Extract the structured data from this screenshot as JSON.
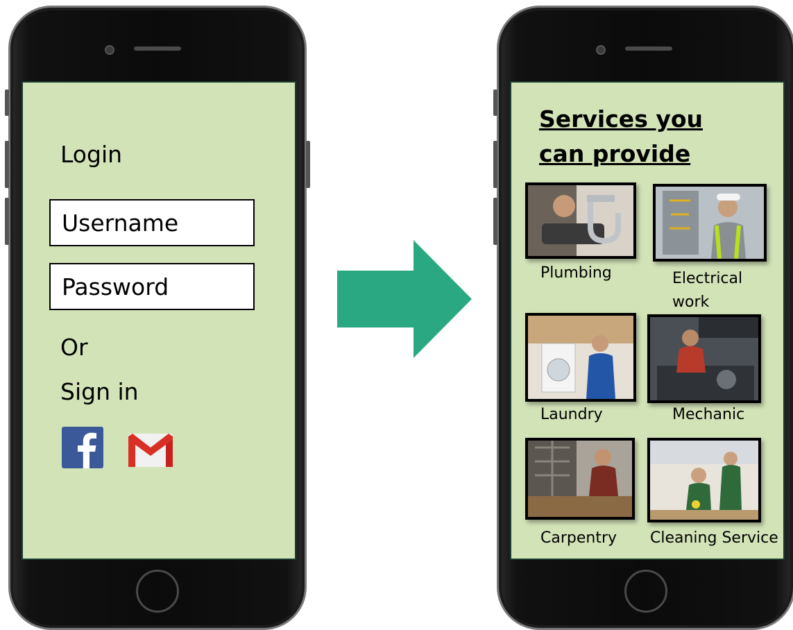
{
  "login_screen": {
    "title": "Login",
    "username_placeholder": "Username",
    "password_placeholder": "Password",
    "or_text": "Or",
    "sign_in_text": "Sign in",
    "social": [
      "facebook-icon",
      "gmail-icon"
    ]
  },
  "services_screen": {
    "heading_line1": "Services you",
    "heading_line2": "can provide",
    "services": [
      {
        "label": "Plumbing",
        "icon": "plumbing-photo"
      },
      {
        "label_line1": "Electrical",
        "label_line2": "work",
        "icon": "electrical-photo"
      },
      {
        "label": "Laundry",
        "icon": "laundry-photo"
      },
      {
        "label": "Mechanic",
        "icon": "mechanic-photo"
      },
      {
        "label": "Carpentry",
        "icon": "carpentry-photo"
      },
      {
        "label": "Cleaning Service",
        "icon": "cleaning-photo"
      }
    ]
  },
  "colors": {
    "screen_bg": "#d3e3b8",
    "arrow": "#2aa882",
    "facebook": "#3b5998",
    "gmail_red": "#d93025"
  }
}
